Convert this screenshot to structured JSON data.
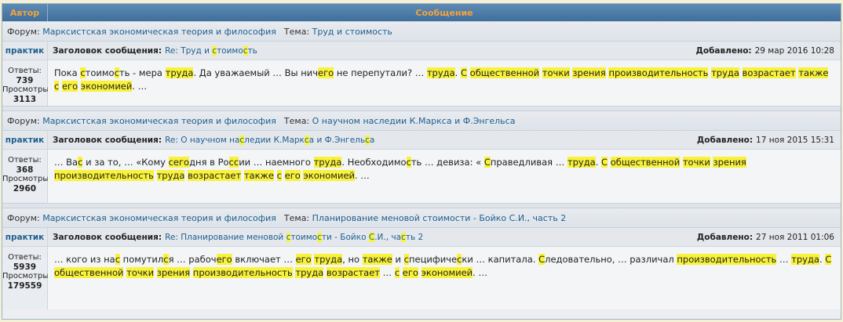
{
  "header": {
    "author_col": "Автор",
    "message_col": "Сообщение"
  },
  "labels": {
    "forum": "Форум:",
    "topic": "Тема:",
    "subject": "Заголовок сообщения:",
    "added": "Добавлено:",
    "replies": "Ответы:",
    "views": "Просмотры:"
  },
  "posts": [
    {
      "forum": "Марксистская экономическая теория и философия",
      "topic": "Труд и стоимость",
      "author": "практик",
      "subject": "Re: Труд и стоимость",
      "date": "29 мар 2016 10:28",
      "replies": "739",
      "views": "3113",
      "text": "Пока стоимость - мера труда. Да уважаемый … Вы ничего не перепутали? … труда. С общественной точки зрения производительность труда возрастает также с его экономией. …"
    },
    {
      "forum": "Марксистская экономическая теория и философия",
      "topic": "О научном наследии К.Маркса и Ф.Энгельса",
      "author": "практик",
      "subject": "Re: О научном наследии К.Маркса и Ф.Энгельса",
      "date": "17 ноя 2015 15:31",
      "replies": "368",
      "views": "2960",
      "text": "… Вас и за то, … «Кому сегодня в России … наемного труда. Необходимость … девиза: « Справедливая … труда. С общественной точки зрения производительность труда возрастает также с его экономией. …"
    },
    {
      "forum": "Марксистская экономическая теория и философия",
      "topic": "Планирование меновой стоимости - Бойко С.И., часть 2",
      "author": "практик",
      "subject": "Re: Планирование меновой стоимости - Бойко С.И., часть 2",
      "date": "27 ноя 2011 01:06",
      "replies": "5939",
      "views": "179559",
      "text": "… кого из нас помутился … рабочего включает … его труда, но также и специфически … капитала. Следовательно, … различал производительность … труда. С общественной точки зрения производительность труда возрастает … с его экономией. …"
    }
  ]
}
